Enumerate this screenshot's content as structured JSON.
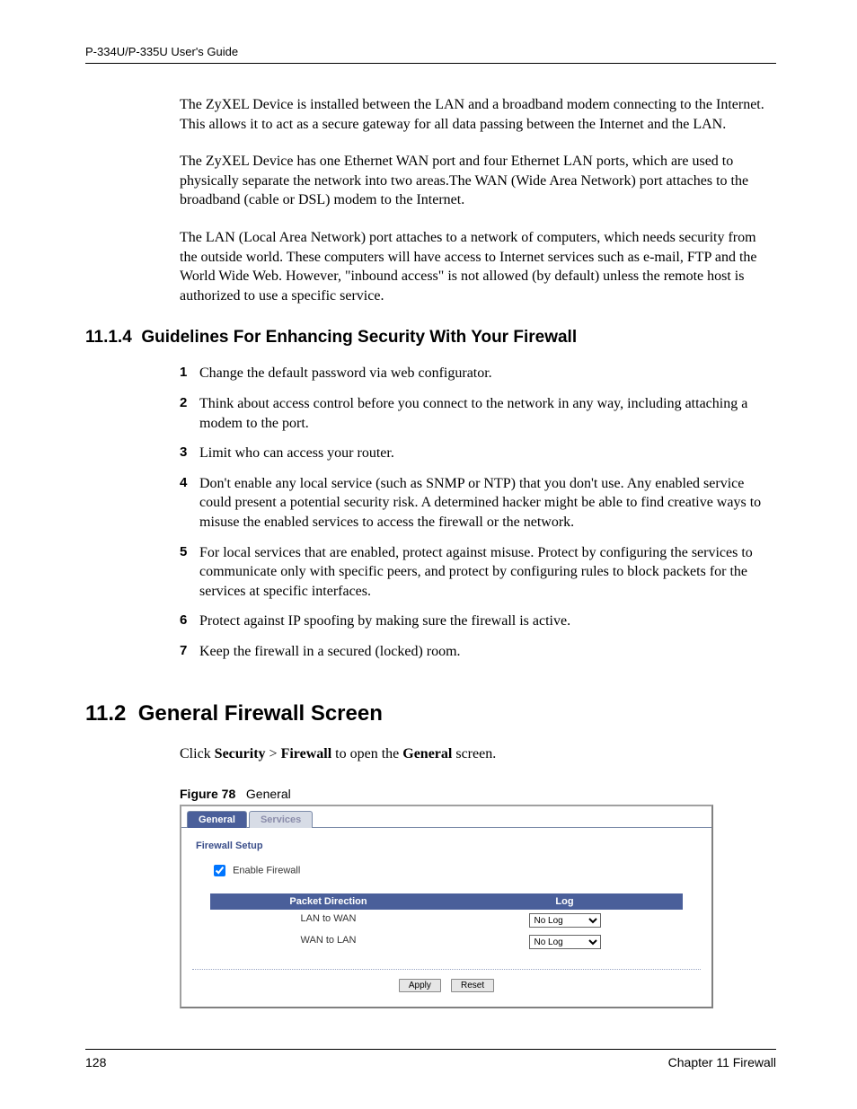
{
  "header": {
    "title": "P-334U/P-335U User's Guide"
  },
  "paras": {
    "p1": "The ZyXEL Device is installed between the LAN and a broadband modem connecting to the Internet. This allows it to act as a secure gateway for all data passing between the Internet and the LAN.",
    "p2": "The ZyXEL Device has one Ethernet WAN port and four Ethernet LAN ports, which are used to physically separate the network into two areas.The WAN (Wide Area Network) port attaches to the broadband (cable or DSL) modem to the Internet.",
    "p3": "The LAN (Local Area Network) port attaches to a network of computers, which needs security from the outside world. These computers will have access to Internet services such as e-mail, FTP and the World Wide Web. However, \"inbound access\" is not allowed (by default) unless the remote host is authorized to use a specific service."
  },
  "sect1": {
    "number": "11.1.4",
    "title": "Guidelines For Enhancing Security With Your Firewall",
    "items": [
      "Change the default password via web configurator.",
      "Think about access control before you connect to the network in any way, including attaching a modem to the port.",
      "Limit who can access your router.",
      "Don't enable any local service (such as SNMP or NTP) that you don't use. Any enabled service could present a potential security risk. A determined hacker might be able to find creative ways to misuse the enabled services to access the firewall or the network.",
      "For local services that are enabled, protect against misuse. Protect by configuring the services to communicate only with specific peers, and protect by configuring rules to block packets for the services at specific interfaces.",
      "Protect against IP spoofing by making sure the firewall is active.",
      "Keep the firewall in a secured (locked) room."
    ]
  },
  "sect2": {
    "number": "11.2",
    "title": "General Firewall Screen",
    "intro_pre": "Click ",
    "intro_b1": "Security",
    "intro_mid": " > ",
    "intro_b2": "Firewall",
    "intro_mid2": " to open the ",
    "intro_b3": "General",
    "intro_post": " screen."
  },
  "figure": {
    "label": "Figure 78",
    "caption": "General"
  },
  "ui": {
    "tabs": {
      "general": "General",
      "services": "Services"
    },
    "panel_title": "Firewall Setup",
    "enable_label": "Enable Firewall",
    "table": {
      "h1": "Packet Direction",
      "h2": "Log",
      "rows": [
        {
          "dir": "LAN to WAN",
          "log": "No Log"
        },
        {
          "dir": "WAN to LAN",
          "log": "No Log"
        }
      ]
    },
    "buttons": {
      "apply": "Apply",
      "reset": "Reset"
    }
  },
  "footer": {
    "page": "128",
    "chapter": "Chapter 11 Firewall"
  }
}
